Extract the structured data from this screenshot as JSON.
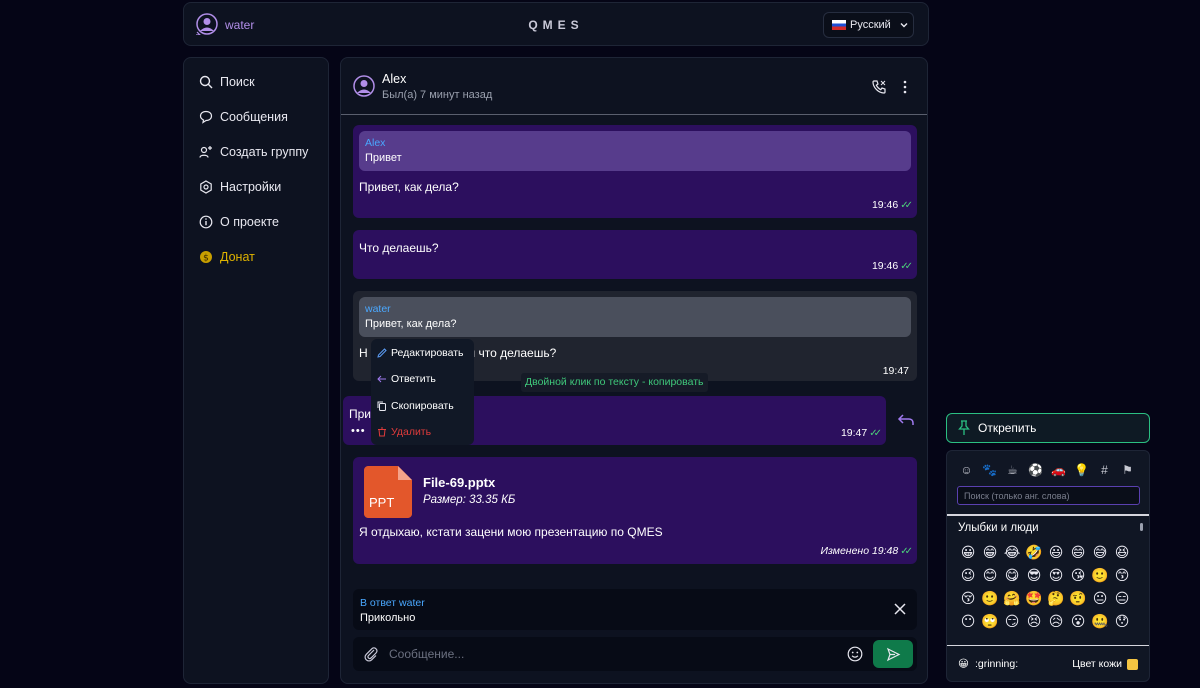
{
  "header": {
    "username": "water",
    "logo": "QMES",
    "language": "Русский"
  },
  "sidebar": {
    "items": [
      {
        "label": "Поиск"
      },
      {
        "label": "Сообщения"
      },
      {
        "label": "Создать группу"
      },
      {
        "label": "Настройки"
      },
      {
        "label": "О проекте"
      },
      {
        "label": "Донат"
      }
    ]
  },
  "chat": {
    "peer_name": "Alex",
    "peer_status": "Был(а) 7 минут назад",
    "messages": [
      {
        "quote_author": "Alex",
        "quote_text": "Привет",
        "text": "Привет, как дела?",
        "time": "19:46"
      },
      {
        "text": "Что делаешь?",
        "time": "19:46"
      },
      {
        "quote_author": "water",
        "quote_text": "Привет, как дела?",
        "text_start": "Н",
        "text_end": "ты что делаешь?",
        "time": "19:47"
      },
      {
        "text": "Прив",
        "time": "19:47"
      },
      {
        "file_icon_label": "PPT",
        "file_name": "File-69.pptx",
        "file_size": "Размер: 33.35 КБ",
        "text": "Я отдыхаю, кстати зацени мою презентацию по QMES",
        "time": "Изменено 19:48"
      }
    ],
    "context_menu": {
      "edit": "Редактировать",
      "reply": "Ответить",
      "copy": "Скопировать",
      "delete": "Удалить"
    },
    "tooltip": "Двойной клик по тексту - копировать",
    "reply_bar": {
      "label": "В ответ water",
      "text": "Прикольно"
    },
    "composer": {
      "placeholder": "Сообщение..."
    }
  },
  "unpin": {
    "label": "Открепить"
  },
  "emoji_picker": {
    "search_placeholder": "Поиск (только анг. слова)",
    "category_title": "Улыбки и люди",
    "categories": [
      "☺",
      "🐾",
      "☕",
      "⚽",
      "🚗",
      "💡",
      "#",
      "⚑"
    ],
    "emojis": [
      "😀",
      "😁",
      "😂",
      "🤣",
      "😃",
      "😄",
      "😅",
      "😆",
      "😉",
      "😊",
      "😋",
      "😎",
      "😍",
      "😘",
      "🙂",
      "😙",
      "😚",
      "🙂",
      "🤗",
      "🤩",
      "🤔",
      "🤨",
      "😐",
      "😑",
      "😶",
      "🙄",
      "😏",
      "😣",
      "😥",
      "😮",
      "🤐",
      "😯"
    ],
    "footer_emoji": "😀",
    "footer_code": ":grinning:",
    "skin_label": "Цвет кожи"
  }
}
